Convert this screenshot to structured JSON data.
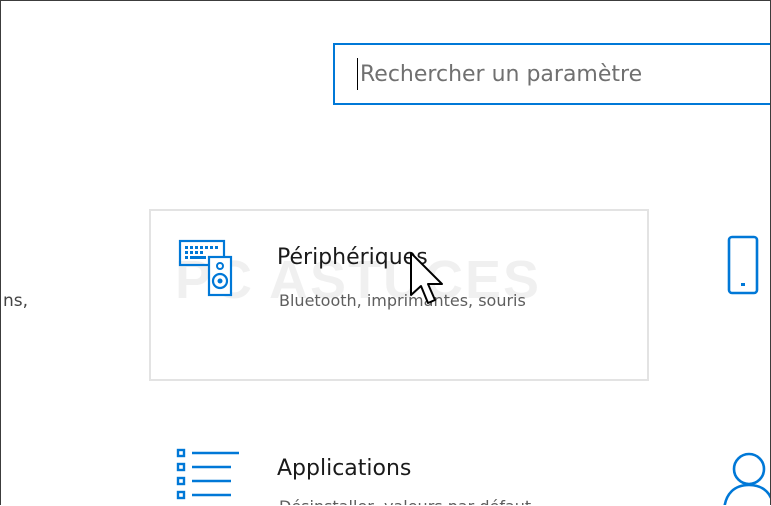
{
  "search": {
    "value": "",
    "placeholder": "Rechercher un paramètre",
    "accent_color": "#0078d7"
  },
  "left_fragment": "ns,",
  "cards": {
    "devices": {
      "icon": "keyboard-speaker-icon",
      "title": "Périphériques",
      "subtitle": "Bluetooth, imprimantes, souris"
    },
    "phone": {
      "icon": "phone-icon"
    },
    "apps": {
      "icon": "apps-list-icon",
      "title": "Applications",
      "subtitle": "Désinstaller, valeurs par défaut"
    },
    "accounts": {
      "icon": "person-icon"
    }
  },
  "watermark": "PC ASTUCES",
  "colors": {
    "icon_blue": "#0078d7",
    "card_border": "#e3e3e3"
  }
}
